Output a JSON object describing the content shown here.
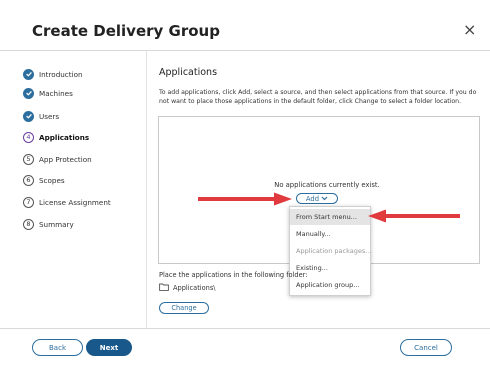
{
  "dialog": {
    "title": "Create Delivery Group",
    "close_glyph": "×"
  },
  "steps": [
    {
      "label": "Introduction",
      "state": "done"
    },
    {
      "label": "Machines",
      "state": "done"
    },
    {
      "label": "Users",
      "state": "done"
    },
    {
      "label": "Applications",
      "state": "current",
      "number": "4"
    },
    {
      "label": "App Protection",
      "state": "todo",
      "number": "5"
    },
    {
      "label": "Scopes",
      "state": "todo",
      "number": "6"
    },
    {
      "label": "License Assignment",
      "state": "todo",
      "number": "7"
    },
    {
      "label": "Summary",
      "state": "todo",
      "number": "8"
    }
  ],
  "main": {
    "heading": "Applications",
    "description": "To add applications, click Add, select a source, and then select applications from that source. If you do not want to place those applications in the default folder, click Change to select a folder location.",
    "empty_text": "No applications currently exist.",
    "add_label": "Add",
    "add_menu": [
      {
        "label": "From Start menu...",
        "highlighted": true,
        "enabled": true
      },
      {
        "label": "Manually...",
        "enabled": true
      },
      {
        "label": "Application packages...",
        "enabled": false
      },
      {
        "label": "Existing...",
        "enabled": true
      },
      {
        "label": "Application group...",
        "enabled": true
      }
    ],
    "folder_prompt": "Place the applications in the following folder:",
    "folder_path": "Applications\\",
    "change_label": "Change"
  },
  "footer": {
    "back_label": "Back",
    "next_label": "Next",
    "cancel_label": "Cancel"
  },
  "colors": {
    "accent": "#2c6e9e",
    "primary_button": "#18588a",
    "annotation_arrow": "#e0393e",
    "current_step": "#6a3fa0"
  }
}
